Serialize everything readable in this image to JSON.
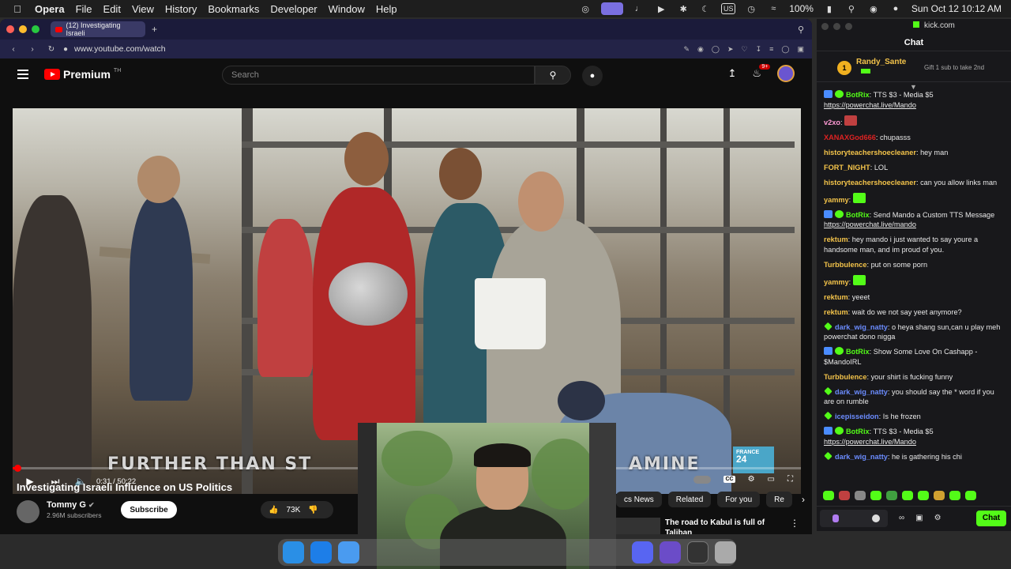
{
  "menubar": {
    "app": "Opera",
    "items": [
      "File",
      "Edit",
      "View",
      "History",
      "Bookmarks",
      "Developer",
      "Window",
      "Help"
    ],
    "battery": "100%",
    "input_source": "US",
    "datetime": "Sun Oct 12  10:12 AM"
  },
  "browser": {
    "tab_title": "(12) Investigating Israeli",
    "url": "www.youtube.com/watch"
  },
  "youtube": {
    "logo_text": "Premium",
    "logo_tm": "TH",
    "search_placeholder": "Search",
    "notification_count": "9+",
    "video": {
      "banner_left": "FURTHER THAN ST",
      "banner_right": "AMINE",
      "channel_logo_line1": "FRANCE",
      "channel_logo_line2": "24",
      "time": "0:31 / 50:22",
      "progress_fraction": 0.01
    },
    "title": "Investigating Israeli Influence on US Politics",
    "channel": "Tommy G",
    "subscribers": "2.96M subscribers",
    "subscribe_label": "Subscribe",
    "likes": "73K",
    "chips": [
      "cs News",
      "Related",
      "For you",
      "Re"
    ],
    "recommendation_title": "The road to Kabul is full of Taliban"
  },
  "kick": {
    "site": "kick.com",
    "panel_title": "Chat",
    "pinned_user": "Randy_Sante",
    "pinned_rank": "1",
    "pinned_text": "Gift 1 sub to take 2nd",
    "send_label": "Chat",
    "messages": [
      {
        "user": "BotRix",
        "color": "#53fc18",
        "text": "TTS $3 - Media $5 ",
        "link": "https://powerchat.live/Mando"
      },
      {
        "user": "v2xo",
        "color": "#ff9ad5",
        "text": ""
      },
      {
        "user": "XANAXGod666",
        "color": "#d22",
        "text": "chupasss"
      },
      {
        "user": "historyteachershoecleaner",
        "color": "#f3c34a",
        "text": "hey man"
      },
      {
        "user": "FORT_NIGHT",
        "color": "#f3c34a",
        "text": "LOL"
      },
      {
        "user": "historyteachershoecleaner",
        "color": "#f3c34a",
        "text": "can you allow links man"
      },
      {
        "user": "yammy",
        "color": "#f3c34a",
        "text": ""
      },
      {
        "user": "BotRix",
        "color": "#53fc18",
        "text": "Send Mando a Custom TTS Message ",
        "link": "https://powerchat.live/mando"
      },
      {
        "user": "rektum",
        "color": "#f3c34a",
        "text": "hey mando i just wanted to say youre a handsome man, and im proud of you."
      },
      {
        "user": "Turbbulence",
        "color": "#f3c34a",
        "text": "put on some porn"
      },
      {
        "user": "yammy",
        "color": "#f3c34a",
        "text": ""
      },
      {
        "user": "rektum",
        "color": "#f3c34a",
        "text": "yeeet"
      },
      {
        "user": "rektum",
        "color": "#f3c34a",
        "text": "wait do we not say yeet anymore?"
      },
      {
        "user": "dark_wig_natty",
        "color": "#6b8cff",
        "text": "o heya shang sun,can u play meh powerchat dono nigga"
      },
      {
        "user": "BotRix",
        "color": "#53fc18",
        "text": "Show Some Love On Cashapp - $MandoIRL"
      },
      {
        "user": "Turbbulence",
        "color": "#f3c34a",
        "text": "your shirt is fucking funny"
      },
      {
        "user": "dark_wig_natty",
        "color": "#6b8cff",
        "text": "you should say the * word if you are on rumble"
      },
      {
        "user": "icepisseidon",
        "color": "#6b8cff",
        "text": "Is he frozen"
      },
      {
        "user": "BotRix",
        "color": "#53fc18",
        "text": "TTS $3 - Media $5 ",
        "link": "https://powerchat.live/Mando"
      },
      {
        "user": "dark_wig_natty",
        "color": "#6b8cff",
        "text": "he is gathering his chi"
      }
    ]
  },
  "colors": {
    "kick_green": "#53fc18",
    "youtube_red": "#ff0000"
  }
}
